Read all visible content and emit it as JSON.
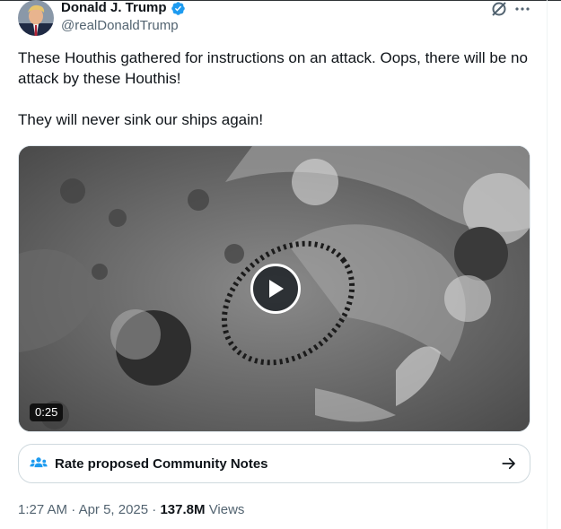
{
  "author": {
    "display_name": "Donald J. Trump",
    "handle": "@realDonaldTrump",
    "verified": true
  },
  "icons": {
    "verified": "verified-badge-icon",
    "grok": "grok-icon",
    "more": "more-icon",
    "play": "play-icon",
    "community_notes": "community-notes-icon",
    "arrow": "arrow-right-icon"
  },
  "tweet": {
    "text_line_1": "These Houthis gathered for instructions on an attack. Oops, there will be no attack by these Houthis!",
    "text_line_2": "They will never sink our ships again!"
  },
  "video": {
    "duration": "0:25"
  },
  "community_notes": {
    "label": "Rate proposed Community Notes"
  },
  "meta": {
    "time": "1:27 AM",
    "separator": "·",
    "date": "Apr 5, 2025",
    "views_count": "137.8M",
    "views_label": "Views"
  },
  "colors": {
    "text_primary": "#0f1419",
    "text_secondary": "#536471",
    "verified_blue": "#1d9bf0",
    "border": "#cfd9de"
  }
}
